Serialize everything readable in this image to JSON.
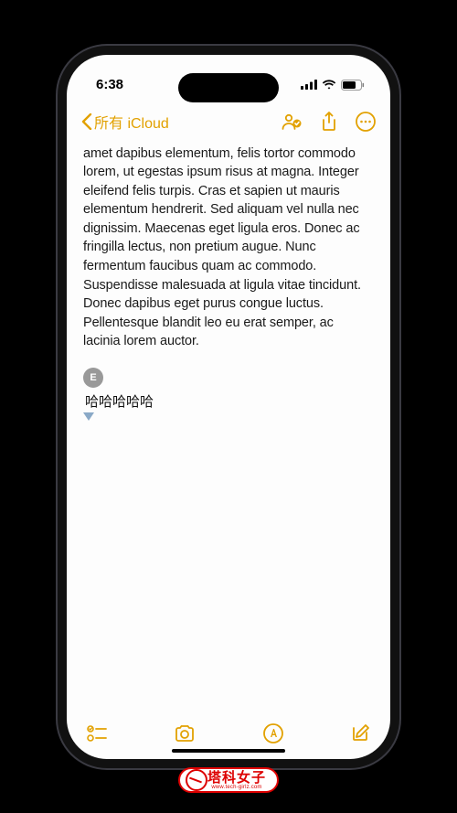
{
  "status": {
    "time": "6:38"
  },
  "nav": {
    "back_label": "所有 iCloud"
  },
  "note": {
    "body": "amet dapibus elementum, felis tortor commodo lorem, ut egestas ipsum risus at magna. Integer eleifend felis turpis. Cras et sapien ut mauris elementum hendrerit. Sed aliquam vel nulla nec dignissim. Maecenas eget ligula eros. Donec ac fringilla lectus, non pretium augue. Nunc fermentum faucibus quam ac commodo. Suspendisse malesuada at ligula vitae tincidunt. Donec dapibus eget purus congue luctus. Pellentesque blandit leo eu erat semper, ac lacinia lorem auctor."
  },
  "comment": {
    "avatar_initial": "E",
    "text": "哈哈哈哈哈"
  },
  "watermark": {
    "title": "塔科女子",
    "url": "www.tech-girlz.com"
  }
}
